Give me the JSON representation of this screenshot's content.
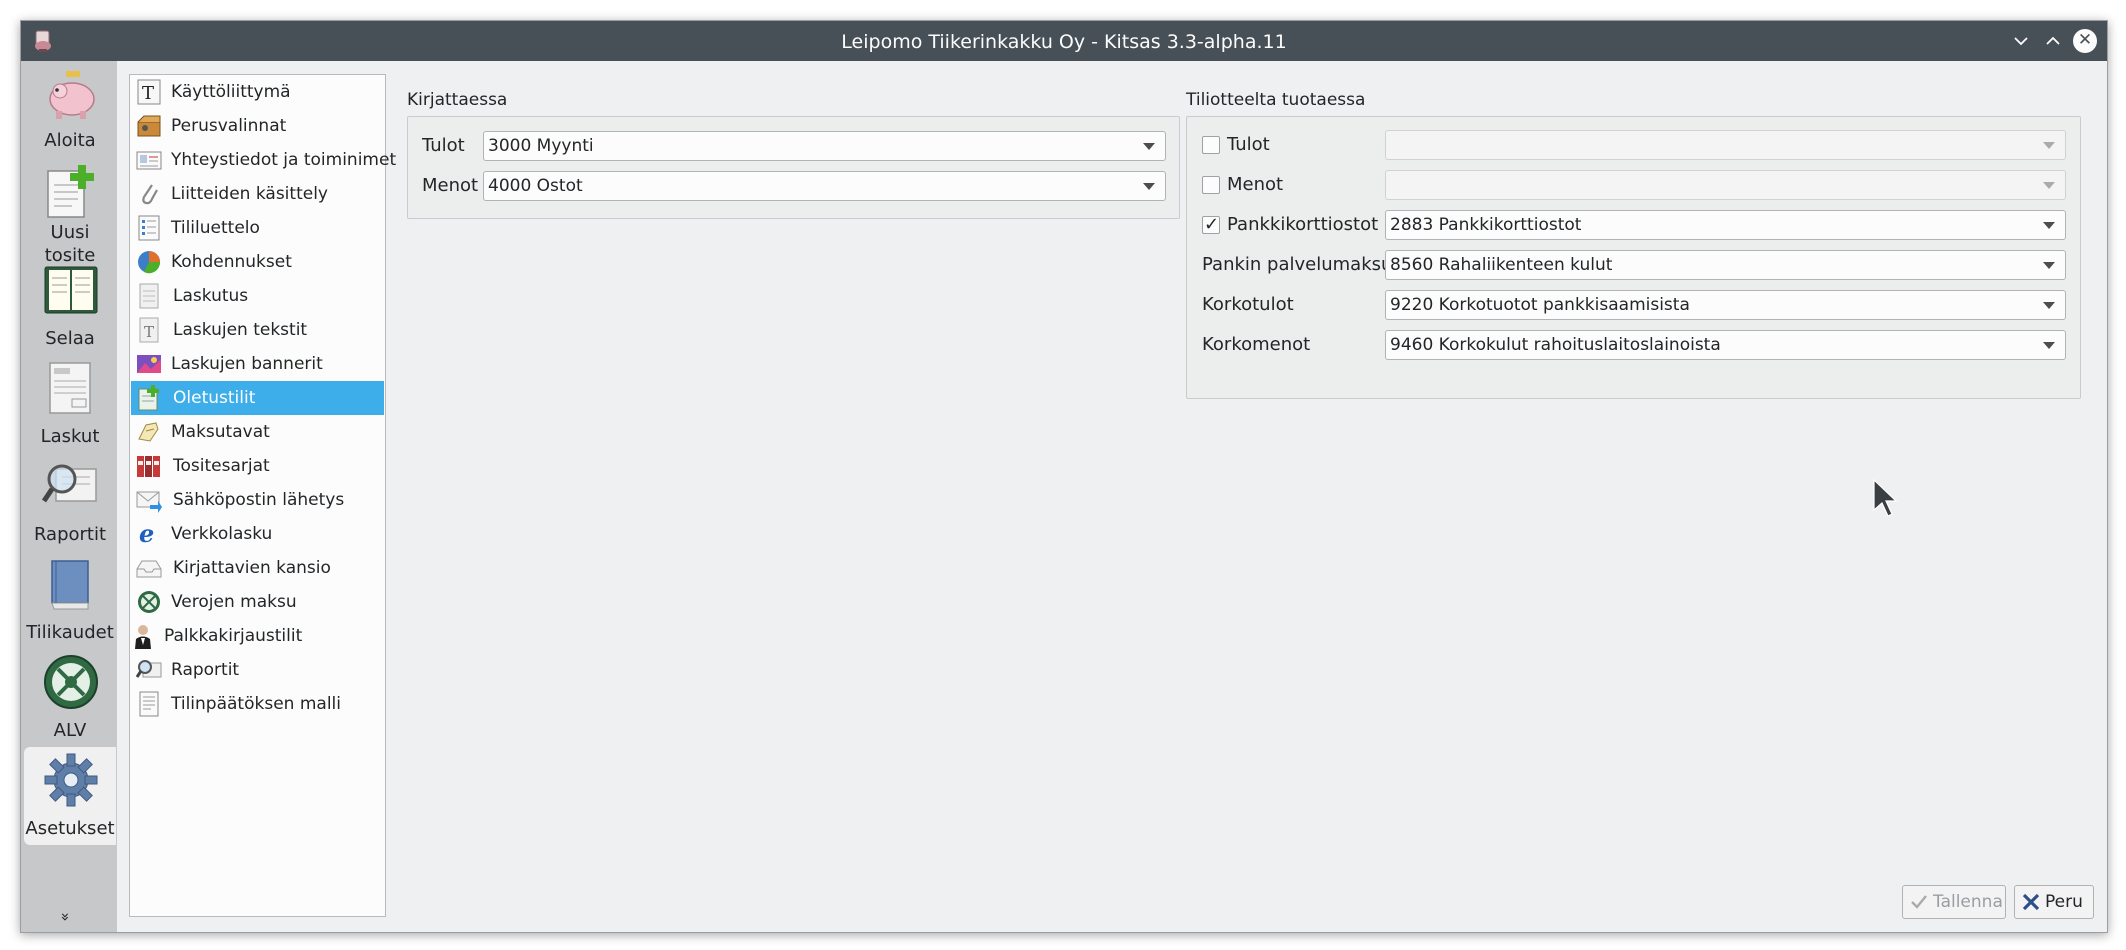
{
  "window": {
    "title": "Leipomo Tiikerinkakku Oy - Kitsas 3.3-alpha.11"
  },
  "nav": {
    "items": [
      {
        "label": "Aloita",
        "icon": "piggy-bank-icon"
      },
      {
        "label": "Uusi\ntosite",
        "icon": "new-document-icon"
      },
      {
        "label": "Selaa",
        "icon": "ledger-book-icon"
      },
      {
        "label": "Laskut",
        "icon": "invoice-icon"
      },
      {
        "label": "Raportit",
        "icon": "report-magnifier-icon"
      },
      {
        "label": "Tilikaudet",
        "icon": "blue-book-icon"
      },
      {
        "label": "ALV",
        "icon": "vat-seal-icon"
      },
      {
        "label": "Asetukset",
        "icon": "gear-icon"
      }
    ],
    "active": "Asetukset",
    "more": "»"
  },
  "settings_list": {
    "items": [
      "Käyttöliittymä",
      "Perusvalinnat",
      "Yhteystiedot ja toiminimet",
      "Liitteiden käsittely",
      "Tililuettelo",
      "Kohdennukset",
      "Laskutus",
      "Laskujen tekstit",
      "Laskujen bannerit",
      "Oletustilit",
      "Maksutavat",
      "Tositesarjat",
      "Sähköpostin lähetys",
      "Verkkolasku",
      "Kirjattavien kansio",
      "Verojen maksu",
      "Palkkakirjaustilit",
      "Raportit",
      "Tilinpäätöksen malli"
    ],
    "selected": "Oletustilit"
  },
  "kirjattaessa": {
    "title": "Kirjattaessa",
    "tulot_label": "Tulot",
    "tulot_value": "3000 Myynti",
    "menot_label": "Menot",
    "menot_value": "4000 Ostot"
  },
  "tiliotteelta": {
    "title": "Tiliotteelta tuotaessa",
    "tulot_label": "Tulot",
    "tulot_checked": false,
    "tulot_value": "",
    "menot_label": "Menot",
    "menot_checked": false,
    "menot_value": "",
    "pankkikortti_label": "Pankkikorttiostot",
    "pankkikortti_checked": true,
    "pankkikortti_value": "2883 Pankkikorttiostot",
    "palvelumaksut_label": "Pankin palvelumaksut",
    "palvelumaksut_value": "8560 Rahaliikenteen kulut",
    "korkotulot_label": "Korkotulot",
    "korkotulot_value": "9220 Korkotuotot pankkisaamisista",
    "korkomenot_label": "Korkomenot",
    "korkomenot_value": "9460 Korkokulut rahoituslaitoslainoista"
  },
  "buttons": {
    "save_label": "Tallenna",
    "cancel_label": "Peru"
  },
  "colors": {
    "selection": "#3daee9",
    "titlebar": "#475057",
    "nav_background": "#c7c8c9"
  }
}
